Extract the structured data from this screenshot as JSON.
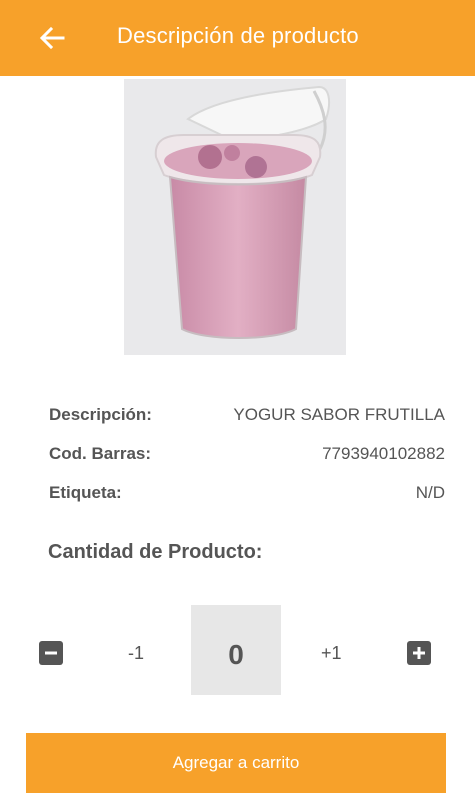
{
  "header": {
    "title": "Descripción de producto",
    "back_icon": "arrow-left-icon",
    "background": "#f7a12a"
  },
  "product": {
    "image_subject": "yogurt-cup",
    "details": [
      {
        "label": "Descripción:",
        "value": "YOGUR SABOR FRUTILLA"
      },
      {
        "label": "Cod. Barras:",
        "value": "7793940102882"
      },
      {
        "label": "Etiqueta:",
        "value": "N/D"
      }
    ]
  },
  "quantity": {
    "title": "Cantidad de Producto:",
    "minus_icon": "minus-square-icon",
    "plus_icon": "plus-square-icon",
    "decrement_label": "-1",
    "increment_label": "+1",
    "value": "0"
  },
  "actions": {
    "add_to_cart_label": "Agregar a carrito",
    "accent": "#f7a12a"
  }
}
